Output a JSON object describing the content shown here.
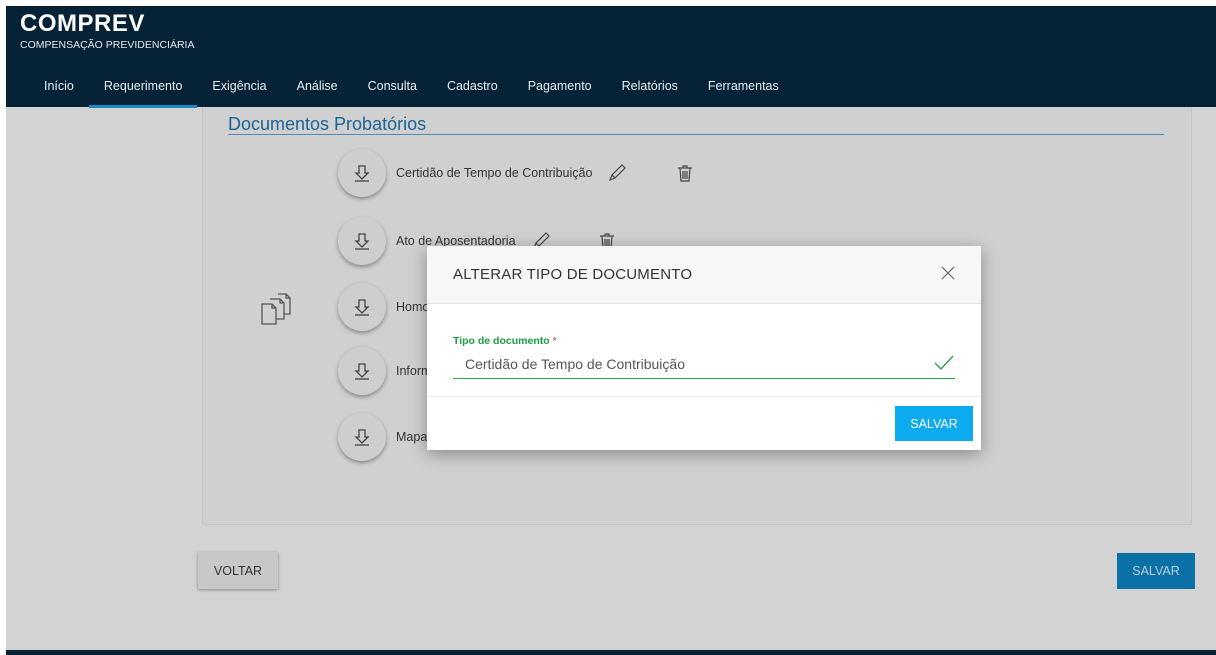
{
  "header": {
    "title": "COMPREV",
    "subtitle": "COMPENSAÇÃO PREVIDENCIÁRIA",
    "nav": [
      "Início",
      "Requerimento",
      "Exigência",
      "Análise",
      "Consulta",
      "Cadastro",
      "Pagamento",
      "Relatórios",
      "Ferramentas"
    ],
    "active_nav": "Requerimento"
  },
  "section": {
    "title": "Documentos Probatórios"
  },
  "documents": [
    {
      "label": "Certidão de Tempo de Contribuição"
    },
    {
      "label": "Ato de Aposentadoria"
    },
    {
      "label": "Homo"
    },
    {
      "label": "Inform"
    },
    {
      "label": "Mapa"
    }
  ],
  "actions": {
    "back_label": "VOLTAR",
    "save_label": "SALVAR"
  },
  "modal": {
    "title": "ALTERAR TIPO DE DOCUMENTO",
    "field_label": "Tipo de documento",
    "required_mark": "*",
    "field_value": "Certidão de Tempo de Contribuição",
    "save_label": "SALVAR"
  },
  "colors": {
    "header_bg": "#052236",
    "active_tab_underline": "#1d86c4",
    "valid_green": "#27a544",
    "primary_button": "#0cabf0"
  }
}
